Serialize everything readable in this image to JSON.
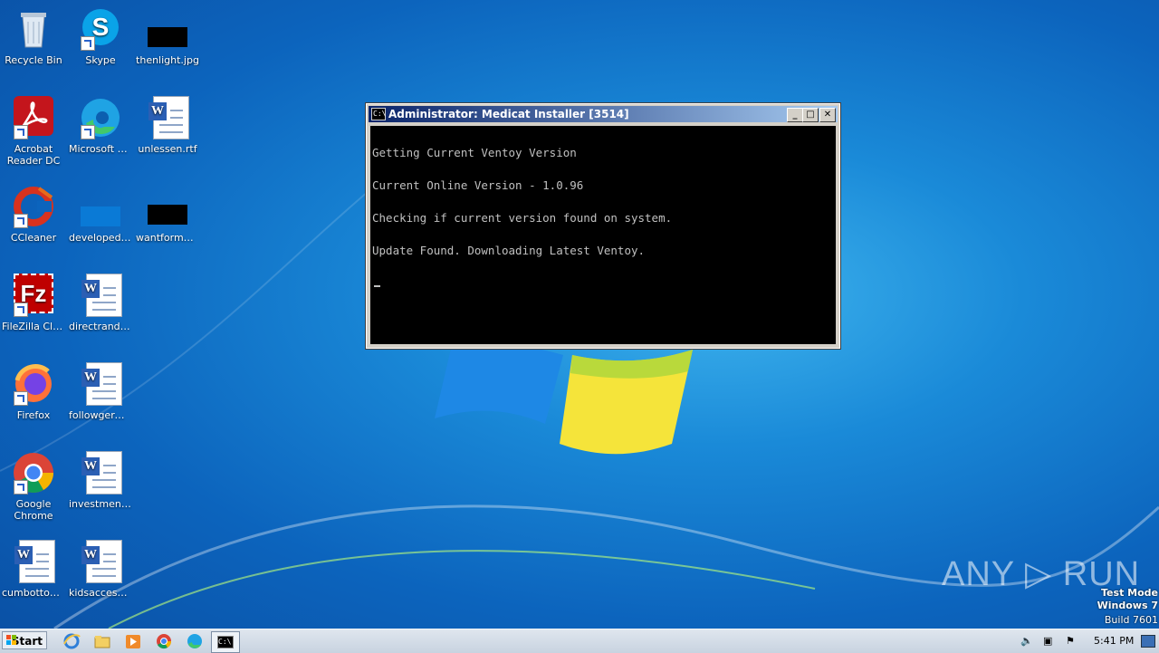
{
  "desktop": {
    "icons": [
      {
        "label": "Recycle Bin"
      },
      {
        "label": "Skype"
      },
      {
        "label": "thenlight.jpg"
      },
      {
        "label": "Acrobat Reader DC"
      },
      {
        "label": "Microsoft Edge"
      },
      {
        "label": "unlessen.rtf"
      },
      {
        "label": "CCleaner"
      },
      {
        "label": "developedb..."
      },
      {
        "label": "wantformer..."
      },
      {
        "label": "FileZilla Client"
      },
      {
        "label": "directrando..."
      },
      {
        "label": "Firefox"
      },
      {
        "label": "followgerm..."
      },
      {
        "label": "Google Chrome"
      },
      {
        "label": "investment..."
      },
      {
        "label": "cumbottom.rtf"
      },
      {
        "label": "kidsaccess.rtf"
      }
    ]
  },
  "console_window": {
    "title": "Administrator:  Medicat Installer [3514]",
    "icon_text": "C:\\",
    "lines": [
      "Getting Current Ventoy Version",
      "Current Online Version - 1.0.96",
      "Checking if current version found on system.",
      "Update Found. Downloading Latest Ventoy."
    ],
    "minimize": "_",
    "maximize": "□",
    "close": "✕"
  },
  "watermark": {
    "brand": "ANY ▷ RUN",
    "line1": "Test Mode",
    "line2": "Windows 7",
    "line3": "Build 7601"
  },
  "taskbar": {
    "start_label": "Start",
    "clock": "5:41 PM",
    "pinned": [
      "internet-explorer-icon",
      "explorer-icon",
      "media-player-icon",
      "chrome-icon",
      "edge-icon",
      "cmd-icon"
    ]
  }
}
